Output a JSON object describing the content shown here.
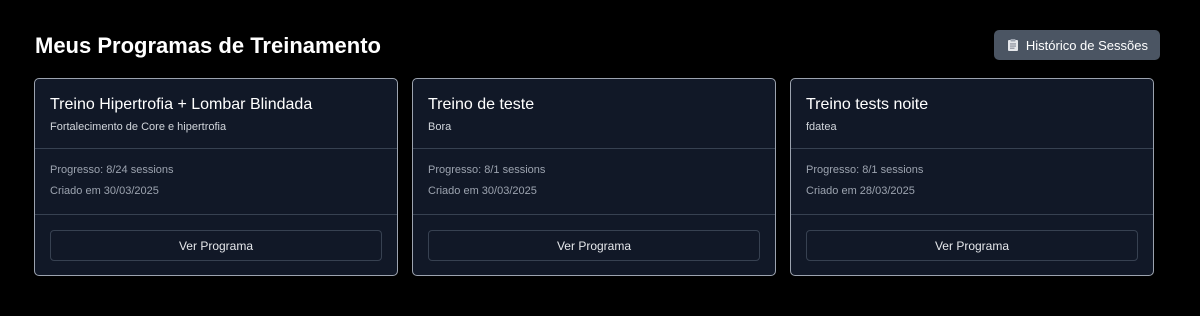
{
  "header": {
    "title": "Meus Programas de Treinamento",
    "history_button": {
      "label": "Histórico de Sessões",
      "icon": "clipboard-icon"
    }
  },
  "programs": [
    {
      "title": "Treino Hipertrofia + Lombar Blindada",
      "description": "Fortalecimento de Core e hipertrofia",
      "progress": "Progresso: 8/24 sessions",
      "created": "Criado em 30/03/2025",
      "action_label": "Ver Programa"
    },
    {
      "title": "Treino de teste",
      "description": "Bora",
      "progress": "Progresso: 8/1 sessions",
      "created": "Criado em 30/03/2025",
      "action_label": "Ver Programa"
    },
    {
      "title": "Treino tests noite",
      "description": "fdatea",
      "progress": "Progresso: 8/1 sessions",
      "created": "Criado em 28/03/2025",
      "action_label": "Ver Programa"
    }
  ],
  "colors": {
    "background": "#000000",
    "card_background": "#111827",
    "card_border": "#9ca3af",
    "button_background": "#4b5563"
  }
}
